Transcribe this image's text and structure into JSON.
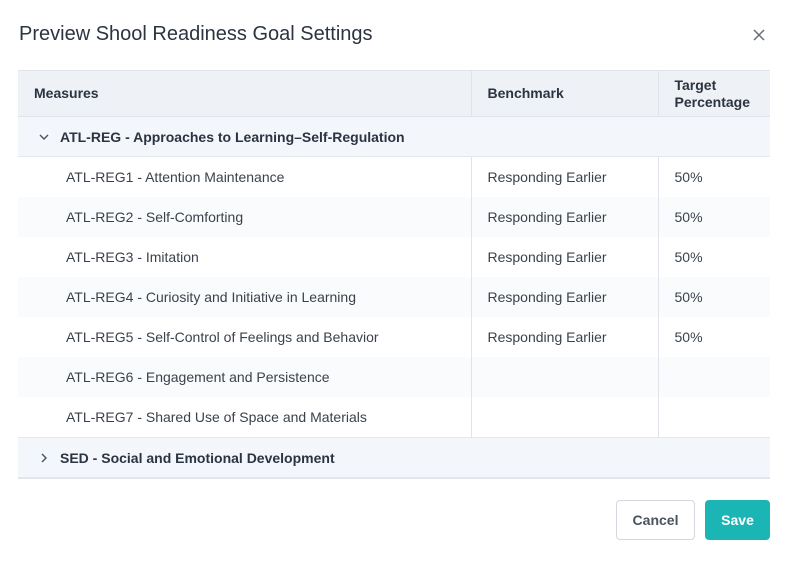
{
  "dialog": {
    "title": "Preview Shool Readiness Goal Settings",
    "close_label": "×"
  },
  "table": {
    "headers": {
      "measures": "Measures",
      "benchmark": "Benchmark",
      "target_line1": "Target",
      "target_line2": "Percentage"
    },
    "groups": [
      {
        "label": "ATL-REG - Approaches to Learning–Self-Regulation",
        "expanded": true,
        "items": [
          {
            "measure": "ATL-REG1 - Attention Maintenance",
            "benchmark": "Responding Earlier",
            "target": "50%"
          },
          {
            "measure": "ATL-REG2 - Self-Comforting",
            "benchmark": "Responding Earlier",
            "target": "50%"
          },
          {
            "measure": "ATL-REG3 - Imitation",
            "benchmark": "Responding Earlier",
            "target": "50%"
          },
          {
            "measure": "ATL-REG4 - Curiosity and Initiative in Learning",
            "benchmark": "Responding Earlier",
            "target": "50%"
          },
          {
            "measure": "ATL-REG5 - Self-Control of Feelings and Behavior",
            "benchmark": "Responding Earlier",
            "target": "50%"
          },
          {
            "measure": "ATL-REG6 - Engagement and Persistence",
            "benchmark": "",
            "target": ""
          },
          {
            "measure": "ATL-REG7 - Shared Use of Space and Materials",
            "benchmark": "",
            "target": ""
          }
        ]
      },
      {
        "label": "SED - Social and Emotional Development",
        "expanded": false,
        "items": []
      }
    ]
  },
  "footer": {
    "cancel_label": "Cancel",
    "save_label": "Save"
  },
  "colors": {
    "accent": "#1bb5b5",
    "header_bg": "#eef1f6",
    "group_bg": "#f3f6fb"
  }
}
